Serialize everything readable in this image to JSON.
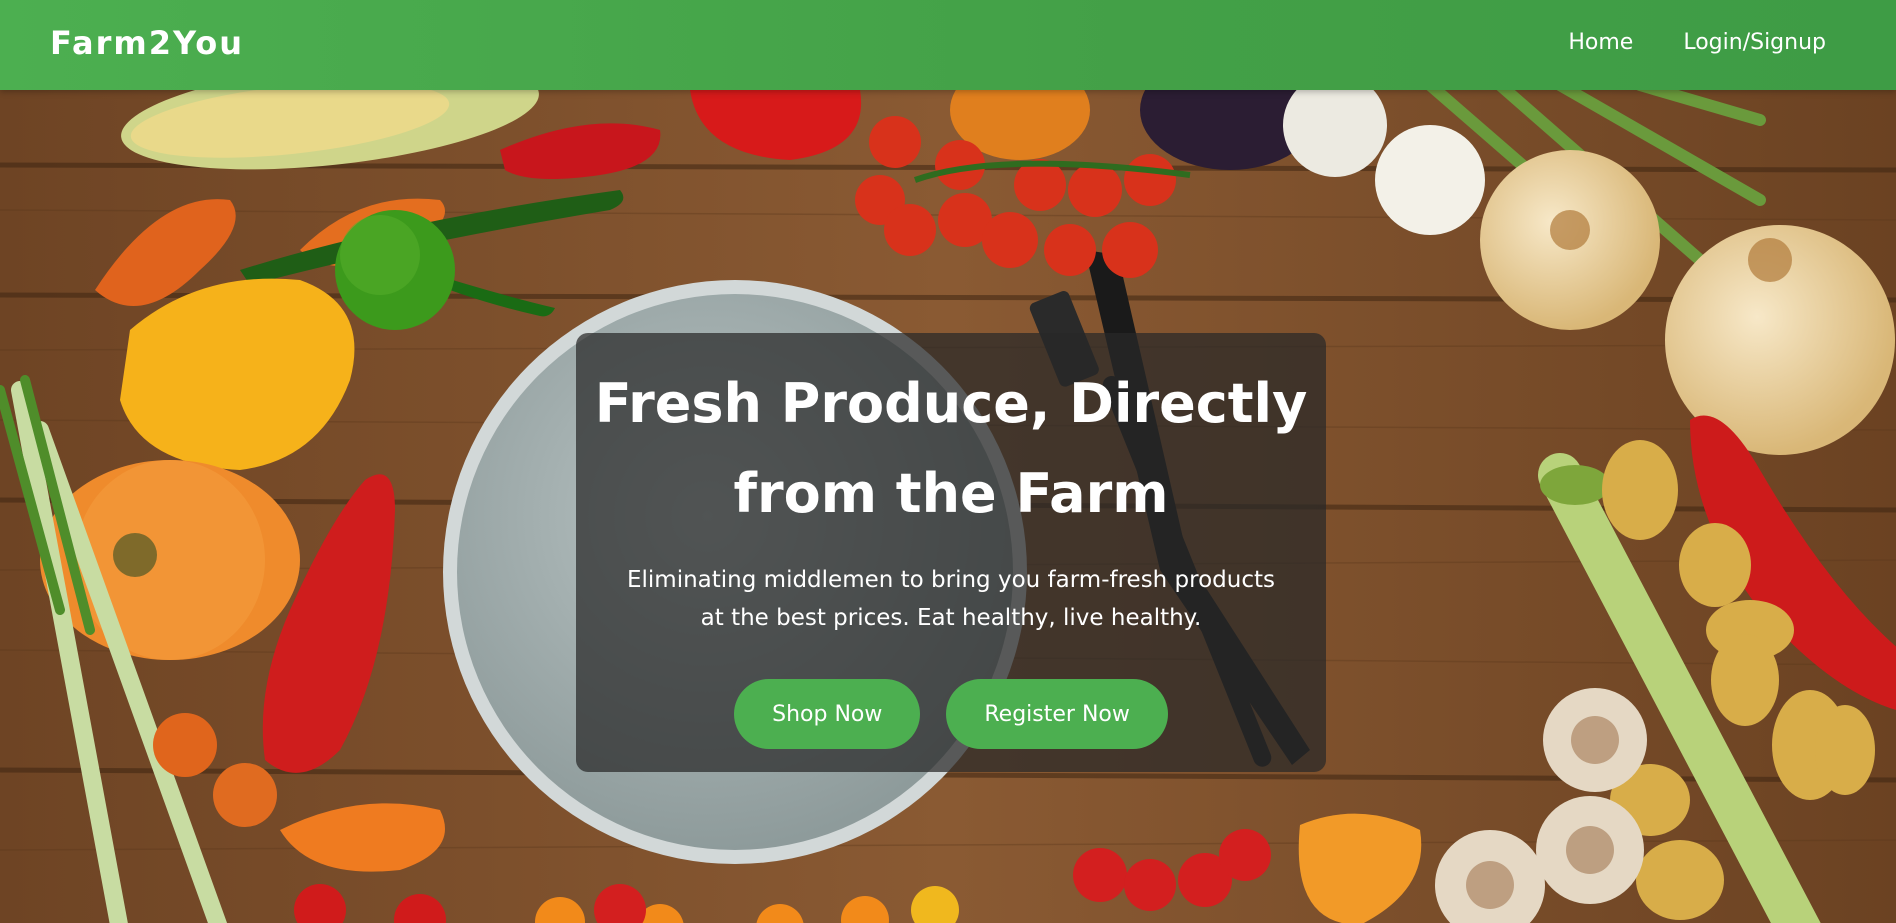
{
  "navbar": {
    "brand": "Farm2You",
    "links": [
      {
        "label": "Home"
      },
      {
        "label": "Login/Signup"
      }
    ]
  },
  "hero": {
    "title": "Fresh Produce, Directly from the Farm",
    "subtitle": "Eliminating middlemen to bring you farm-fresh products at the best prices. Eat healthy, live healthy.",
    "buttons": {
      "shop_label": "Shop Now",
      "register_label": "Register Now"
    }
  },
  "colors": {
    "brand_green": "#4caf50",
    "wood": "#7a4e2c",
    "card_overlay": "rgba(40,40,40,0.72)"
  },
  "icons": [
    "dinner-plate",
    "fork",
    "knife"
  ]
}
